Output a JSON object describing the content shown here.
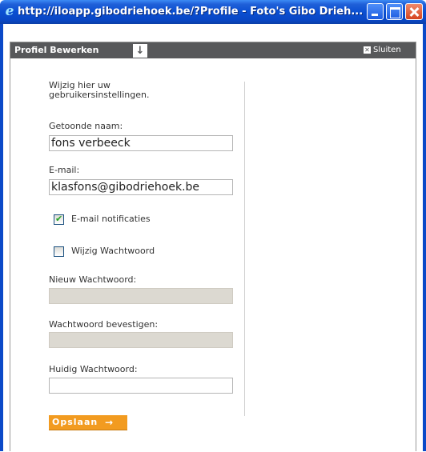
{
  "window": {
    "title": "http://iloapp.gibodriehoek.be/?Profile - Foto's Gibo Drieh...",
    "icon": "ie-icon",
    "titlebar_color": "#0a4fd2"
  },
  "dialog": {
    "title": "Profiel Bewerken",
    "close_label": "Sluiten",
    "header_color": "#57585a"
  },
  "form": {
    "intro": "Wijzig hier uw gebruikersinstellingen.",
    "display_name_label": "Getoonde naam:",
    "display_name_value": "fons verbeeck",
    "email_label": "E-mail:",
    "email_value": "klasfons@gibodriehoek.be",
    "email_notifications_label": "E-mail notificaties",
    "email_notifications_checked": true,
    "change_password_label": "Wijzig Wachtwoord",
    "change_password_checked": false,
    "new_password_label": "Nieuw Wachtwoord:",
    "confirm_password_label": "Wachtwoord bevestigen:",
    "current_password_label": "Huidig Wachtwoord:",
    "save_label": "Opslaan",
    "save_color": "#f29b20"
  }
}
